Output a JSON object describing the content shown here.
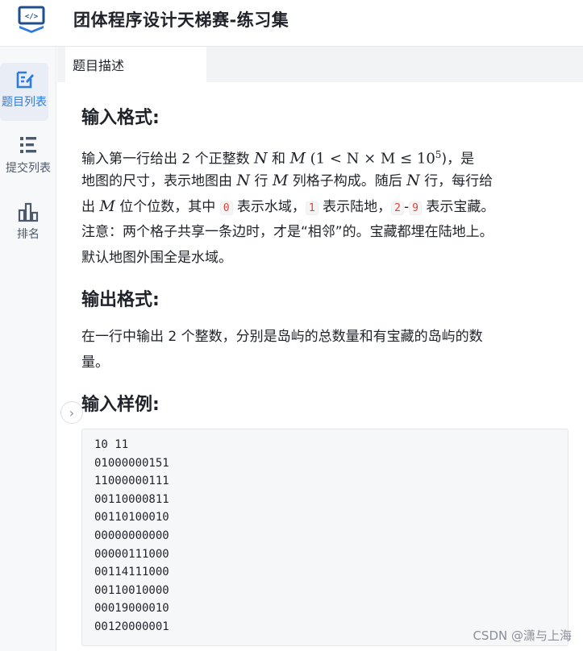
{
  "app": {
    "title": "团体程序设计天梯赛-练习集"
  },
  "sidebar": {
    "items": [
      {
        "label": "题目列表",
        "icon": "edit-list-icon",
        "active": true
      },
      {
        "label": "提交列表",
        "icon": "bullet-list-icon",
        "active": false
      },
      {
        "label": "排名",
        "icon": "bar-chart-icon",
        "active": false
      }
    ]
  },
  "tabs": [
    {
      "label": "题目描述"
    }
  ],
  "problem": {
    "input_title": "输入格式:",
    "input_p1_a": "输入第一行给出 2 个正整数 ",
    "input_p1_N": "N",
    "input_p1_b": " 和 ",
    "input_p1_M": "M",
    "input_p1_c": " (1 < N × M ≤ 10",
    "input_p1_sup": "5",
    "input_p1_d": ")，是",
    "input_p2_a": "地图的尺寸，表示地图由 ",
    "input_p2_N": "N",
    "input_p2_b": " 行 ",
    "input_p2_M": "M",
    "input_p2_c": " 列格子构成。随后 ",
    "input_p2_N2": "N",
    "input_p2_d": " 行，每行给",
    "input_p3_a": "出 ",
    "input_p3_M": "M",
    "input_p3_b": " 位个位数，其中 ",
    "input_p3_code0": "0",
    "input_p3_c": " 表示水域，",
    "input_p3_code1": "1",
    "input_p3_d": " 表示陆地，",
    "input_p3_code2": "2",
    "input_p3_dash": "-",
    "input_p3_code9": "9",
    "input_p3_e": " 表示宝藏。",
    "input_p4": "注意：两个格子共享一条边时，才是“相邻”的。宝藏都埋在陆地上。",
    "input_p5": "默认地图外围全是水域。",
    "output_title": "输出格式:",
    "output_p1": "在一行中输出 2 个整数，分别是岛屿的总数量和有宝藏的岛屿的数",
    "output_p2": "量。",
    "sample_title": "输入样例:",
    "sample_lines": [
      "10 11",
      "01000000151",
      "11000000111",
      "00110000811",
      "00110100010",
      "00000000000",
      "00000111000",
      "00114111000",
      "00110010000",
      "00019000010",
      "00120000001"
    ]
  },
  "watermark": "CSDN @潇与上海",
  "colors": {
    "accent": "#2d7be0",
    "inline_code": "#e0443e",
    "sidebar_bg": "#f7f8fa"
  }
}
